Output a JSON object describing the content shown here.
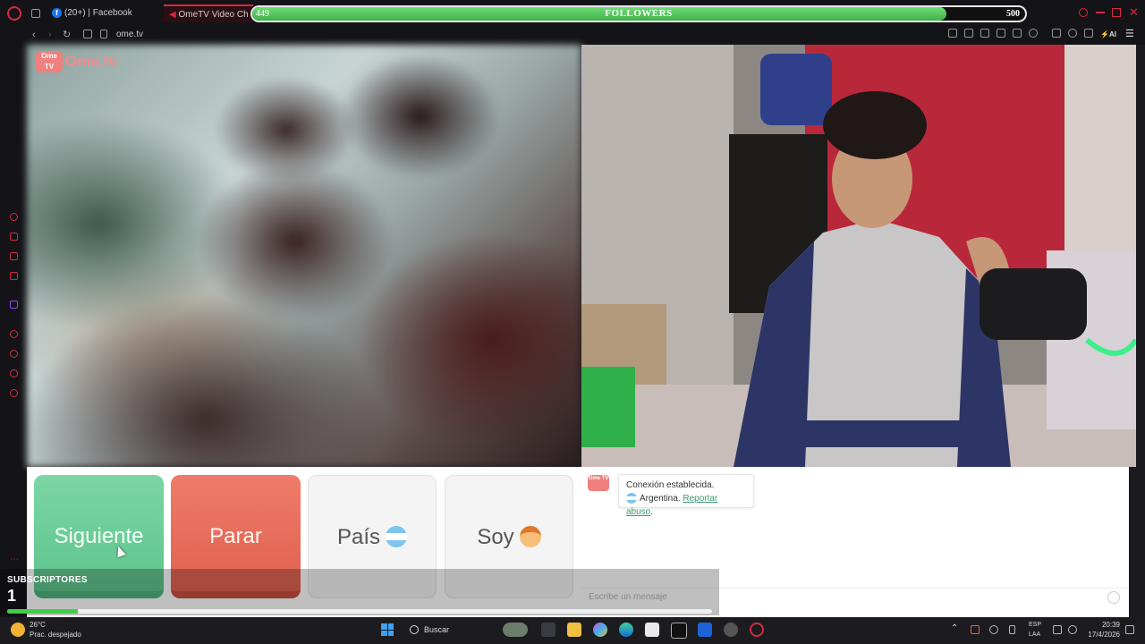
{
  "browser": {
    "tabs": [
      {
        "label": "(20+) | Facebook",
        "badge": "f"
      },
      {
        "label": "OmeTV Video Ch",
        "active": true
      }
    ],
    "url": "ome.tv"
  },
  "followers_bar": {
    "label": "FOLLOWERS",
    "current": "449",
    "goal": "500",
    "progress_fraction": 0.898
  },
  "site": {
    "logo_box": "Ome TV",
    "logo_text": "Ome.tv"
  },
  "controls": {
    "next_label": "Siguiente",
    "stop_label": "Parar",
    "country_label": "País",
    "soy_label": "Soy"
  },
  "chat": {
    "logo_box": "Ome TV",
    "message_line1": "Conexión establecida.",
    "country": "Argentina.",
    "report_link": "Reportar abuso",
    "trailing": ".",
    "input_placeholder": "Escribe un mensaje"
  },
  "subscribers": {
    "label": "SUBSCRIPTORES",
    "count": "1",
    "progress_fraction": 0.1
  },
  "taskbar": {
    "temperature": "26°C",
    "weather": "Prac. despejado",
    "search_label": "Buscar",
    "lang_top": "ESP",
    "lang_bottom": "LAA",
    "time": "20:39",
    "date": "17/4/2026"
  },
  "colors": {
    "accent_red": "#d6293e",
    "next_green": "#5fc48c",
    "stop_red": "#e0614e",
    "progress_green": "#3fb24a"
  }
}
